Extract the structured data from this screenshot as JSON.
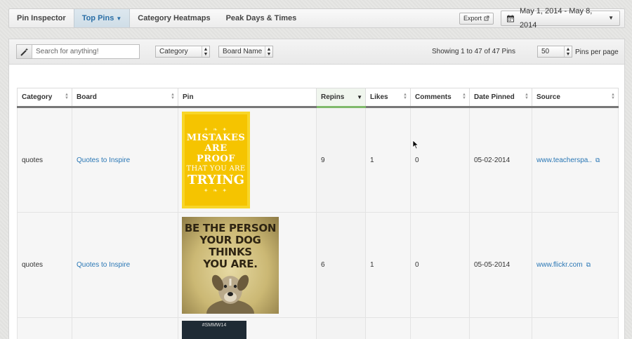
{
  "nav": {
    "tabs": [
      {
        "label": "Pin Inspector"
      },
      {
        "label": "Top Pins"
      },
      {
        "label": "Category Heatmaps"
      },
      {
        "label": "Peak Days & Times"
      }
    ],
    "export_label": "Export",
    "date_range": "May 1, 2014 - May 8, 2014"
  },
  "toolbar": {
    "search_placeholder": "Search for anything!",
    "category_select": "Category",
    "board_select": "Board Name",
    "showing": "Showing 1 to 47 of 47 Pins",
    "per_page_value": "50",
    "per_page_label": "Pins per page"
  },
  "table": {
    "headers": [
      "Category",
      "Board",
      "Pin",
      "Repins",
      "Likes",
      "Comments",
      "Date Pinned",
      "Source"
    ],
    "rows": [
      {
        "category": "quotes",
        "board": "Quotes to Inspire",
        "pin_lines": [
          "MISTAKES",
          "ARE PROOF",
          "THAT YOU ARE",
          "TRYING"
        ],
        "repins": "9",
        "likes": "1",
        "comments": "0",
        "date": "05-02-2014",
        "source": "www.teacherspa.."
      },
      {
        "category": "quotes",
        "board": "Quotes to Inspire",
        "pin_lines": [
          "BE THE PERSON",
          "YOUR DOG THINKS",
          "YOU ARE."
        ],
        "repins": "6",
        "likes": "1",
        "comments": "0",
        "date": "05-05-2014",
        "source": "www.flickr.com"
      },
      {
        "pin_lines": [
          "#SMMW14"
        ]
      }
    ]
  },
  "colors": {
    "accent": "#2a6ea6",
    "link": "#2a77b5",
    "pin_yellow": "#f5c400",
    "sorted_header": "#7fb96a"
  },
  "icons": [
    "caret-down-icon",
    "external-link-icon",
    "calendar-icon",
    "magic-wand-icon",
    "sort-icon",
    "mouse-cursor-icon"
  ]
}
